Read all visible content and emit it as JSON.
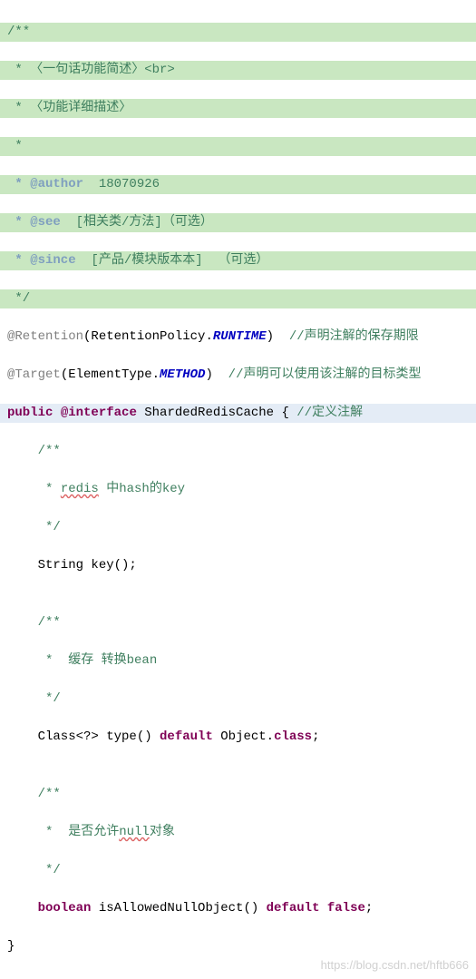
{
  "c1": "/**",
  "c2": " * 〈一句话功能简述〉<br>",
  "c3": " * 〈功能详细描述〉",
  "c4": " *",
  "tag_author": " * @author",
  "author_val": "  18070926",
  "tag_see": " * @see",
  "see_val": "  [相关类/方法]（可选）",
  "tag_since": " * @since",
  "since_val": "  [产品/模块版本本]  （可选）",
  "c5": " */",
  "ann_ret": "@Retention",
  "ret_open": "(RetentionPolicy.",
  "ret_val": "RUNTIME",
  "ret_close": ")  ",
  "ret_comment": "//声明注解的保存期限",
  "ann_tgt": "@Target",
  "tgt_open": "(ElementType.",
  "tgt_val": "METHOD",
  "tgt_close": ")  ",
  "tgt_comment": "//声明可以使用该注解的目标类型",
  "kw_public": "public",
  "kw_interface": "@interface",
  "class_name": " ShardedRedisCache { ",
  "def_comment": "//定义注解",
  "m1_c1": "    /**",
  "m1_c2": "     * ",
  "m1_redis": "redis",
  "m1_c2b": " 中hash的key",
  "m1_c3": "     */",
  "m1_sig": "    String key();",
  "blank": "",
  "m2_c1": "    /**",
  "m2_c2": "     *  缓存 转换bean",
  "m2_c3": "     */",
  "m2_sig_a": "    Class<?> type() ",
  "kw_default": "default",
  "m2_sig_b": " Object.",
  "kw_class": "class",
  "semi": ";",
  "m3_c1": "    /**",
  "m3_c2_a": "     *  是否允许",
  "m3_null": "null",
  "m3_c2_b": "对象",
  "m3_c3": "     */",
  "m3_indent": "    ",
  "kw_boolean": "boolean",
  "m3_name": " isAllowedNullObject() ",
  "kw_false": "false",
  "brace": "}",
  "watermark": "https://blog.csdn.net/hftb666"
}
